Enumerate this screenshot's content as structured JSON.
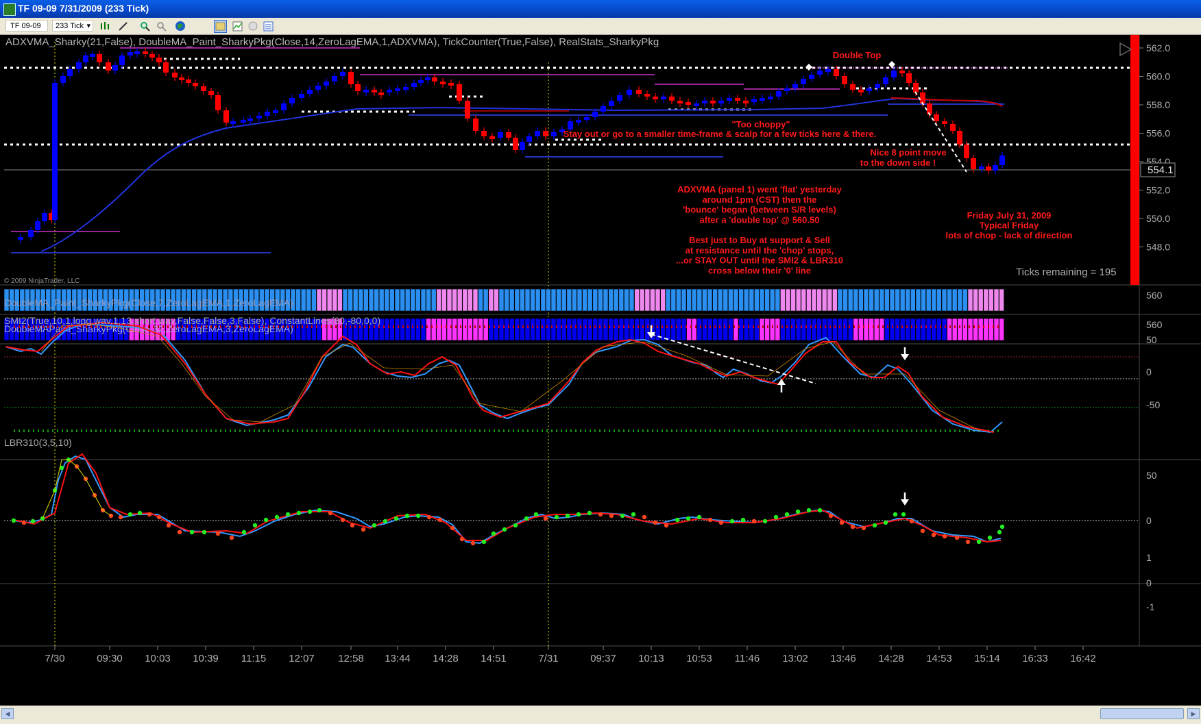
{
  "window": {
    "title": "TF 09-09  7/31/2009 (233 Tick)"
  },
  "toolbar": {
    "instrument": "TF 09-09",
    "period": "233 Tick",
    "icons": [
      "bar-style-icon",
      "draw-tool-icon",
      "zoom-in-icon",
      "zoom-out-icon",
      "globe-icon",
      "chart-trader-icon",
      "indicators-icon",
      "strategies-icon",
      "properties-icon"
    ]
  },
  "panels": {
    "price": {
      "label": "ADXVMA_Sharky(21,False),  DoubleMA_Paint_SharkyPkg(Close,14,ZeroLagEMA,1,ADXVMA),  TickCounter(True,False),  RealStats_SharkyPkg",
      "y_ticks": [
        "562.0",
        "560.0",
        "558.0",
        "556.0",
        "554.0",
        "552.0",
        "550.0",
        "548.0"
      ],
      "current_price": "554.1",
      "copyright": "© 2009 NinjaTrader, LLC",
      "ticks_remaining": "Ticks remaining = 195"
    },
    "paint1": {
      "label": "DoubleMA_Paint_SharkyPkg(Close,7,ZeroLagEMA,1,ZeroLagEMA)",
      "y_tick": "560"
    },
    "paint2": {
      "label": "DoubleMAPaint_SharkyPkg(Close,32,ZeroLagEMA,3,ZeroLagEMA)",
      "y_tick": "560"
    },
    "smi": {
      "label": "SMI2(True,10,1,long.wav,1,13,short.wav,False,False,3,False),  ConstantLines(80,-80,0,0)",
      "y_ticks": [
        "50",
        "0",
        "-50"
      ]
    },
    "lbr": {
      "label": "LBR310(3,5,10)",
      "y_ticks": [
        "50",
        "0"
      ]
    },
    "empty": {
      "y_ticks": [
        "1",
        "0",
        "-1"
      ]
    }
  },
  "x_axis": [
    "7/30",
    "09:30",
    "10:03",
    "10:39",
    "11:15",
    "12:07",
    "12:58",
    "13:44",
    "14:28",
    "14:51",
    "7/31",
    "09:37",
    "10:13",
    "10:53",
    "11:46",
    "13:02",
    "13:46",
    "14:28",
    "14:53",
    "15:14",
    "16:33",
    "16:42"
  ],
  "annotations": {
    "double_top": "Double Top",
    "too_choppy": "\"Too choppy\"",
    "stay_out": "Stay out or go to a smaller time-frame & scalp for a few ticks here & there.",
    "nice_move_1": "Nice 8 point move",
    "nice_move_2": "to the down side !",
    "adx_lines": [
      "ADXVMA (panel 1) went 'flat' yesterday",
      "around 1pm (CST) then the",
      "'bounce' began (between S/R levels)",
      "after a 'double top' @  560.50",
      "",
      "Best just to Buy at support & Sell",
      "at resistance until the 'chop' stops,",
      "...or STAY OUT until the SMI2  & LBR310",
      "cross below their '0' line"
    ],
    "friday_lines": [
      "Friday July 31, 2009",
      "Typical Friday",
      "lots of chop - lack of direction"
    ]
  },
  "colors": {
    "up_bar": "#0000ff",
    "down_bar": "#ff0000",
    "adxvma": "#2233dd",
    "annotation": "#ff0000",
    "paint_blue": "#2a8ff0",
    "paint_pink": "#ee88ee",
    "paint_dark_blue": "#0000ee",
    "paint_magenta": "#ff33ff",
    "sr_lines": "#ffffff"
  }
}
